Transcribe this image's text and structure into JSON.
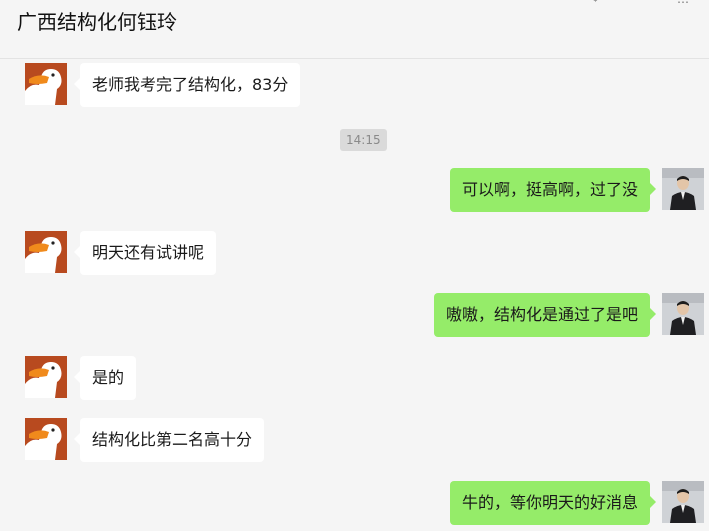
{
  "header": {
    "title": "广西结构化何钰玲"
  },
  "messages": [
    {
      "side": "in",
      "text": "老师我考完了结构化，83分"
    },
    {
      "side": "out",
      "text": "可以啊，挺高啊，过了没"
    },
    {
      "side": "in",
      "text": "明天还有试讲呢"
    },
    {
      "side": "out",
      "text": "嗷嗷，结构化是通过了是吧"
    },
    {
      "side": "in",
      "text": "是的"
    },
    {
      "side": "in",
      "text": "结构化比第二名高十分"
    },
    {
      "side": "out",
      "text": "牛的，等你明天的好消息"
    }
  ],
  "timestamp": "14:15",
  "colors": {
    "outgoing_bubble": "#95ec69",
    "incoming_bubble": "#ffffff",
    "background": "#f5f5f5"
  },
  "icons": {
    "contact_avatar": "duck-cartoon-avatar",
    "self_avatar": "person-photo-avatar"
  }
}
